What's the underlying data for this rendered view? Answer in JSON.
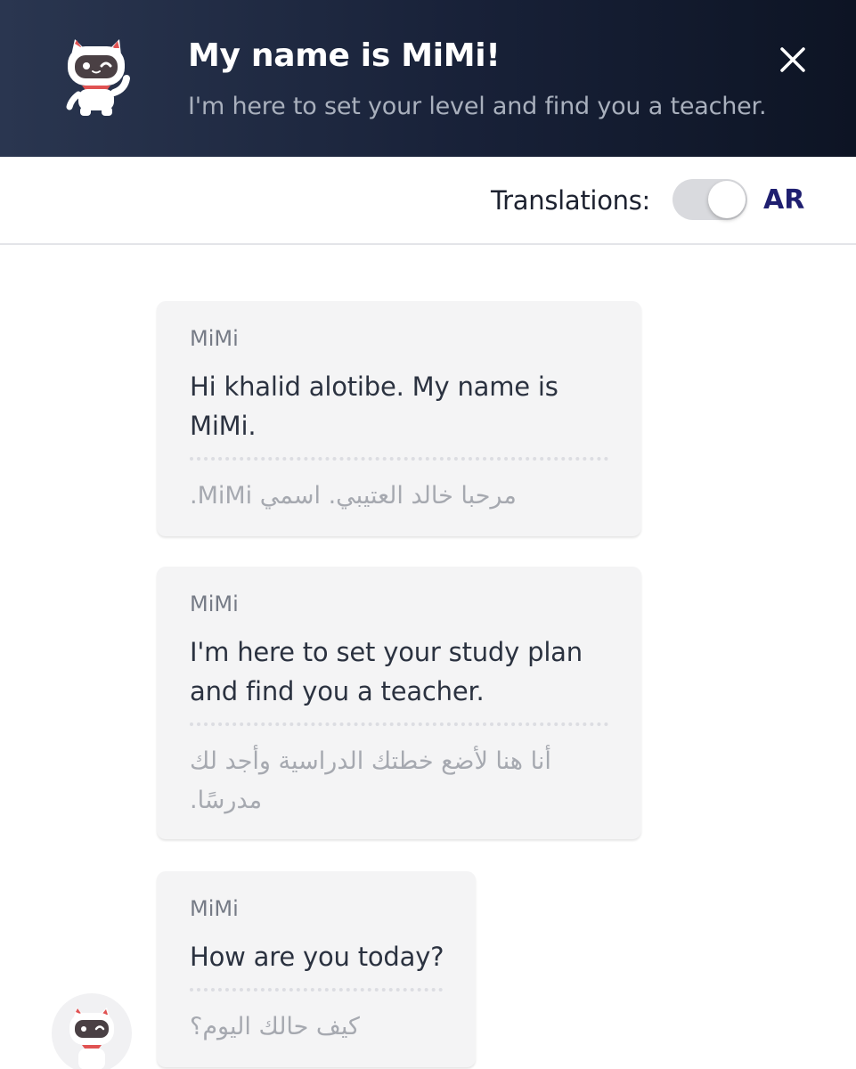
{
  "header": {
    "title": "My name is MiMi!",
    "subtitle": "I'm here to set your level and find you a teacher."
  },
  "translations": {
    "label": "Translations:",
    "enabled": true,
    "language": "AR"
  },
  "messages": [
    {
      "sender": "MiMi",
      "text_lines": [
        "Hi khalid alotibe. My name is",
        "MiMi."
      ],
      "translation_lines": [
        "مرحبا خالد العتيبي. اسمي MiMi."
      ]
    },
    {
      "sender": "MiMi",
      "text_lines": [
        "I'm here to set your study plan",
        "and find you a teacher."
      ],
      "translation_lines": [
        "أنا هنا لأضع خطتك الدراسية وأجد لك",
        "مدرسًا."
      ]
    },
    {
      "sender": "MiMi",
      "text_lines": [
        "How are you today?"
      ],
      "translation_lines": [
        "كيف حالك اليوم؟"
      ]
    }
  ],
  "colors": {
    "header_dark": "#0d1424",
    "header_light": "#2a3650",
    "accent_language": "#1f1f70",
    "bubble_bg": "#f4f4f5"
  },
  "icons": {
    "header_avatar": "mimi-robot-cat-icon",
    "close": "close-icon",
    "bottom_avatar": "mimi-robot-cat-icon"
  }
}
